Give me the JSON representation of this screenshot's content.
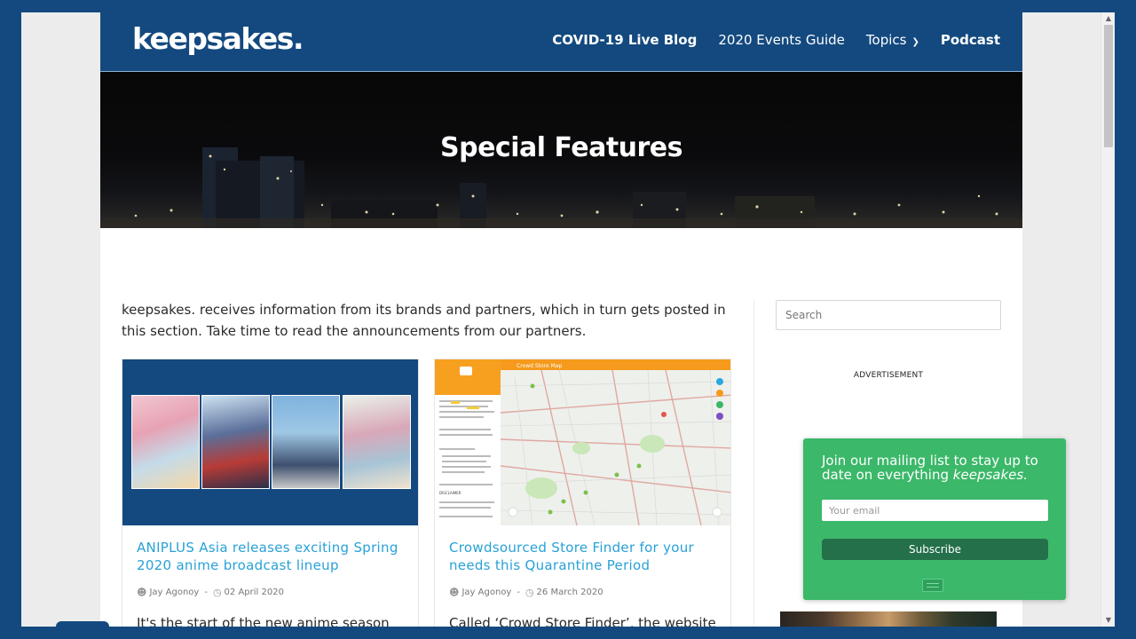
{
  "brand": {
    "logo_text": "keepsakes."
  },
  "nav": {
    "items": [
      {
        "label": "COVID-19 Live Blog",
        "bold": true
      },
      {
        "label": "2020 Events Guide",
        "bold": false
      },
      {
        "label": "Topics",
        "bold": false,
        "has_dropdown": true
      },
      {
        "label": "Podcast",
        "bold": true
      }
    ]
  },
  "hero": {
    "title": "Special Features"
  },
  "intro": "keepsakes. receives information from its brands and partners, which in turn gets posted in this section. Take time to read the announcements from our partners.",
  "posts": [
    {
      "title": "ANIPLUS Asia releases exciting Spring 2020 anime broadcast lineup",
      "author": "Jay Agonoy",
      "date": "02 April 2020",
      "excerpt": "It's the start of the new anime season"
    },
    {
      "title": "Crowdsourced Store Finder for your needs this Quarantine Period",
      "author": "Jay Agonoy",
      "date": "26 March 2020",
      "excerpt": "Called ‘Crowd Store Finder’, the website"
    }
  ],
  "map_thumbnail": {
    "app_title": "Crowd Store Map",
    "sidebar_heading": "DISCLAIMER"
  },
  "sidebar": {
    "search_placeholder": "Search",
    "ad_label": "ADVERTISEMENT"
  },
  "mailing": {
    "text": "Join our mailing list to stay up to date on everything",
    "brand_em": "keepsakes.",
    "email_placeholder": "Your email",
    "button": "Subscribe"
  },
  "colors": {
    "header_bg": "#13497f",
    "link": "#28a1d7",
    "popup_bg": "#3bb869",
    "subscribe_bg": "#24704a"
  }
}
